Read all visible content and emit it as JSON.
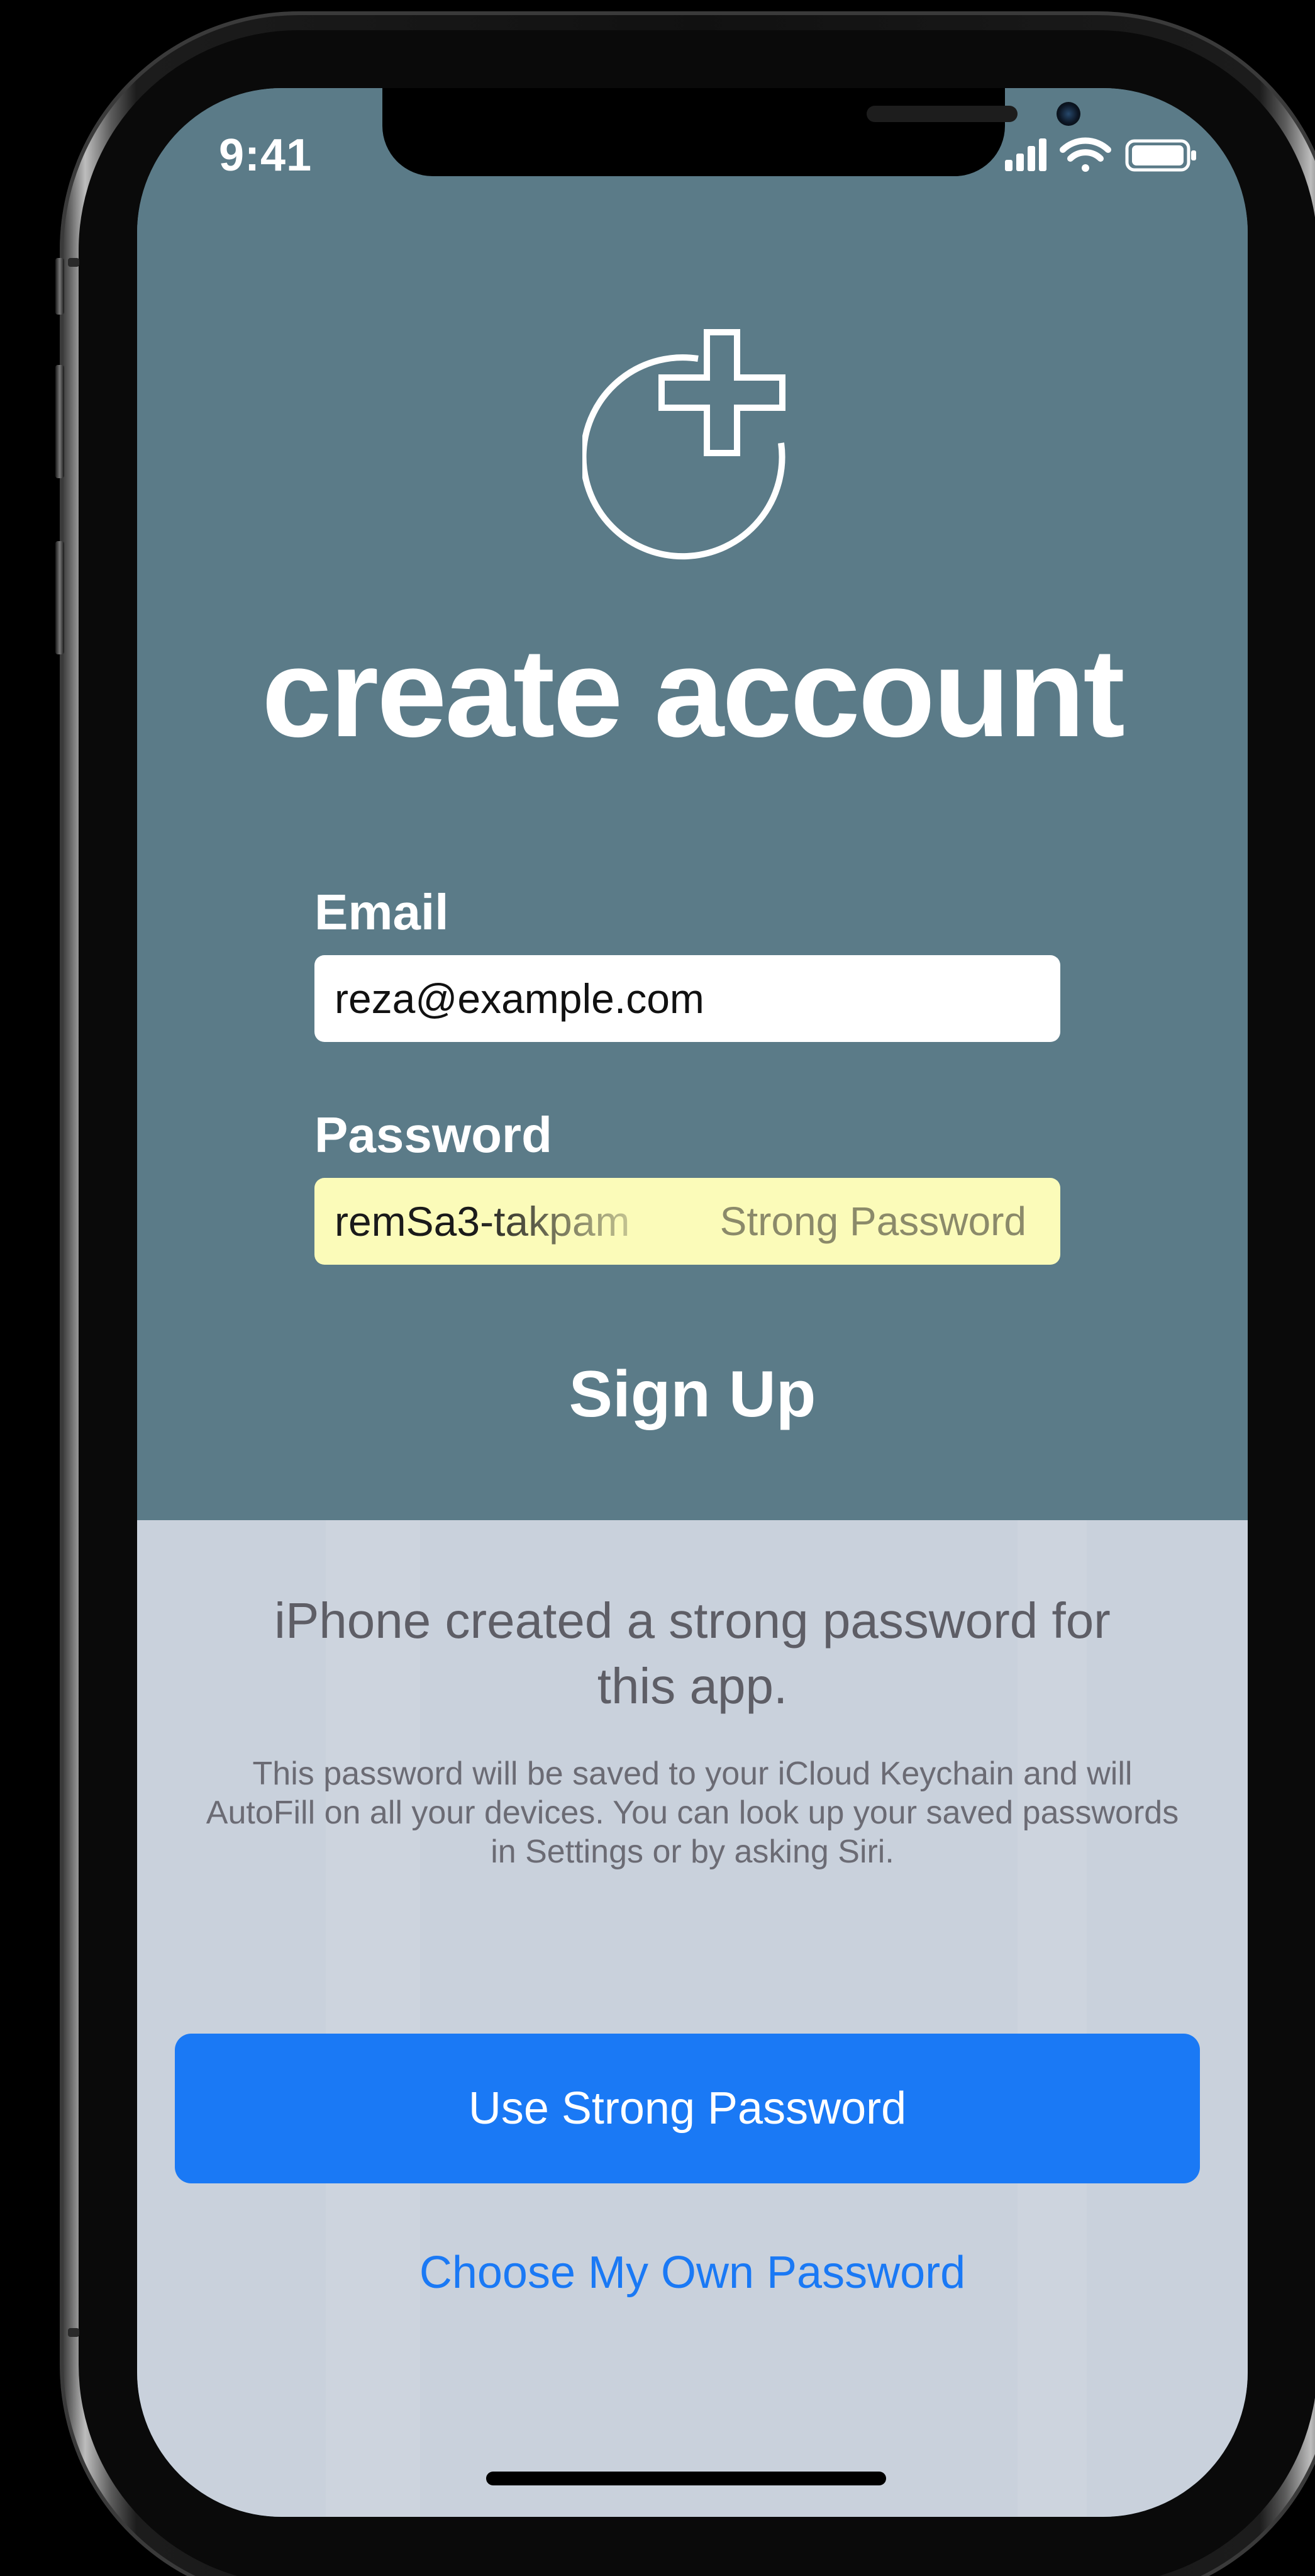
{
  "status_bar": {
    "time": "9:41",
    "signal_icon": "cellular-signal-icon",
    "wifi_icon": "wifi-icon",
    "battery_icon": "battery-icon"
  },
  "app": {
    "logo_icon": "add-user-circle-plus-icon",
    "title": "create account"
  },
  "form": {
    "email_label": "Email",
    "email_value": "reza@example.com",
    "password_label": "Password",
    "password_value": "remSa3-takpam",
    "password_badge": "Strong Password",
    "signup_label": "Sign Up"
  },
  "sheet": {
    "headline": "iPhone created a strong password for this app.",
    "body": "This password will be saved to your iCloud Keychain and will AutoFill on all your devices. You can look up your saved passwords in Settings or by asking Siri.",
    "primary_button": "Use Strong Password",
    "secondary_button": "Choose My Own Password"
  },
  "colors": {
    "header_background": "#5b7b88",
    "sheet_background": "#c9d1dc",
    "accent_blue": "#1a79f5",
    "autofill_yellow": "#fbfbb9"
  }
}
